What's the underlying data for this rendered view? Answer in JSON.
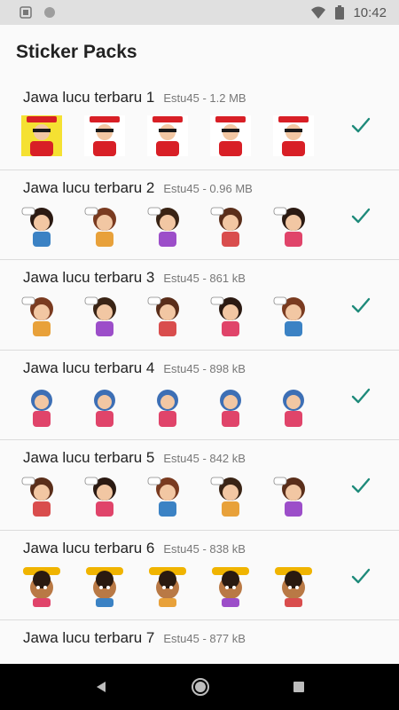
{
  "status_bar": {
    "time": "10:42"
  },
  "app_bar": {
    "title": "Sticker Packs"
  },
  "packs": [
    {
      "name": "Jawa lucu terbaru  1",
      "meta": "Estu45 - 1.2 MB",
      "style": "bold"
    },
    {
      "name": "Jawa lucu terbaru  2",
      "meta": "Estu45 - 0.96 MB",
      "style": "girl"
    },
    {
      "name": "Jawa lucu terbaru  3",
      "meta": "Estu45 - 861 kB",
      "style": "woman"
    },
    {
      "name": "Jawa lucu terbaru  4",
      "meta": "Estu45 - 898 kB",
      "style": "hijab"
    },
    {
      "name": "Jawa lucu terbaru  5",
      "meta": "Estu45 - 842 kB",
      "style": "lady"
    },
    {
      "name": "Jawa lucu terbaru  6",
      "meta": "Estu45 - 838 kB",
      "style": "kid"
    },
    {
      "name": "Jawa lucu terbaru  7",
      "meta": "Estu45 - 877 kB",
      "style": "partial"
    }
  ],
  "colors": {
    "accent": "#1e8a7a",
    "divider": "#dcdcdc",
    "status_bar": "#e0e0e0",
    "nav_bar": "#000000"
  },
  "icons": {
    "status_left": [
      "image-icon",
      "circle-icon"
    ],
    "status_right": [
      "wifi-icon",
      "battery-icon"
    ],
    "nav": [
      "back-icon",
      "home-icon",
      "recents-icon"
    ],
    "pack_state": "check-icon"
  }
}
